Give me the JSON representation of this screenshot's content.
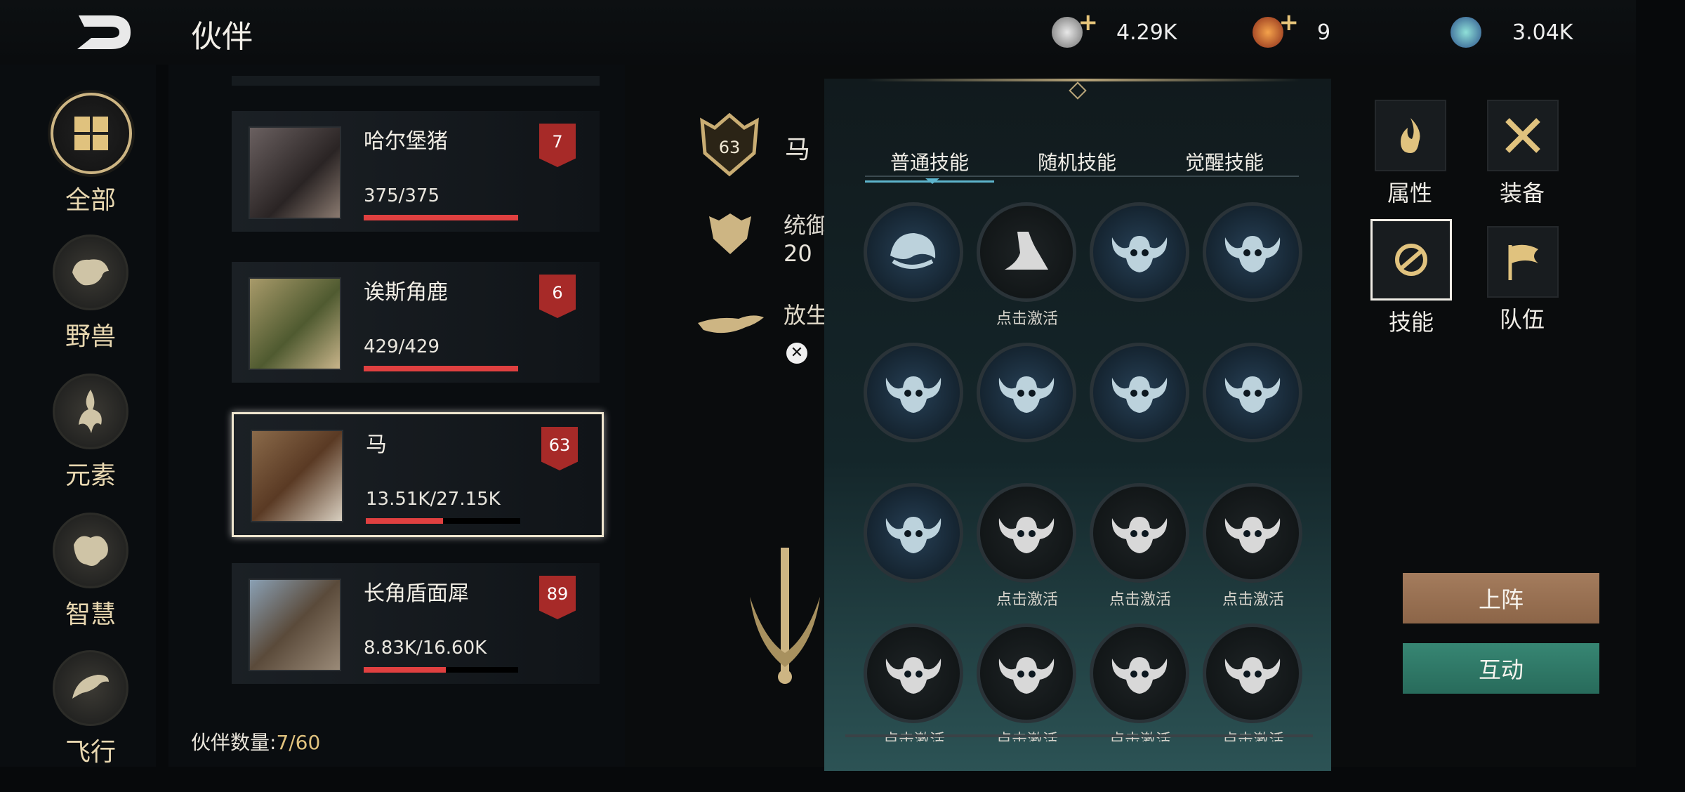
{
  "header": {
    "title": "伙伴",
    "currencies": [
      {
        "icon": "silver-coin-icon",
        "value": "4.29K",
        "has_plus": true
      },
      {
        "icon": "red-gem-icon",
        "value": "9",
        "has_plus": true
      },
      {
        "icon": "blue-orb-icon",
        "value": "3.04K",
        "has_plus": false
      }
    ]
  },
  "left_nav": {
    "items": [
      {
        "label": "全部",
        "icon": "grid-icon",
        "active": true
      },
      {
        "label": "野兽",
        "icon": "beast-icon",
        "active": false
      },
      {
        "label": "元素",
        "icon": "element-icon",
        "active": false
      },
      {
        "label": "智慧",
        "icon": "wisdom-icon",
        "active": false
      },
      {
        "label": "飞行",
        "icon": "flying-icon",
        "active": false
      }
    ]
  },
  "partners": [
    {
      "name": "哈尔堡猪",
      "hp": "375/375",
      "hp_ratio": 1.0,
      "level": "7",
      "selected": false
    },
    {
      "name": "诶斯角鹿",
      "hp": "429/429",
      "hp_ratio": 1.0,
      "level": "6",
      "selected": false
    },
    {
      "name": "马",
      "hp": "13.51K/27.15K",
      "hp_ratio": 0.5,
      "level": "63",
      "selected": true
    },
    {
      "name": "长角盾面犀",
      "hp": "8.83K/16.60K",
      "hp_ratio": 0.53,
      "level": "89",
      "selected": false
    }
  ],
  "partner_count": {
    "label": "伙伴数量:",
    "value": "7/60"
  },
  "detail": {
    "level": "63",
    "name": "马",
    "stat_label": "统御值:",
    "stat_value": "20",
    "release_label": "放生"
  },
  "skills": {
    "tabs": [
      "普通技能",
      "随机技能",
      "觉醒技能"
    ],
    "active_tab": 0,
    "grid": [
      {
        "icon": "helmet-skill-icon",
        "caption": "",
        "active": true
      },
      {
        "icon": "claw-skill-icon",
        "caption": "点击激活",
        "active": false
      },
      {
        "icon": "bull-skill-icon",
        "caption": "",
        "active": true
      },
      {
        "icon": "bull-skill-icon",
        "caption": "",
        "active": true
      },
      {
        "icon": "bull-skill-icon",
        "caption": "",
        "active": true
      },
      {
        "icon": "bull-skill-icon",
        "caption": "",
        "active": true
      },
      {
        "icon": "bull-skill-icon",
        "caption": "",
        "active": true
      },
      {
        "icon": "bull-skill-icon",
        "caption": "",
        "active": true
      },
      {
        "icon": "bull-skill-icon",
        "caption": "",
        "active": true
      },
      {
        "icon": "bull-skill-icon",
        "caption": "点击激活",
        "active": false
      },
      {
        "icon": "bull-skill-icon",
        "caption": "点击激活",
        "active": false
      },
      {
        "icon": "bull-skill-icon",
        "caption": "点击激活",
        "active": false
      },
      {
        "icon": "bull-skill-icon",
        "caption": "点击激活",
        "active": false
      },
      {
        "icon": "bull-skill-icon",
        "caption": "点击激活",
        "active": false
      },
      {
        "icon": "bull-skill-icon",
        "caption": "点击激活",
        "active": false
      },
      {
        "icon": "bull-skill-icon",
        "caption": "点击激活",
        "active": false
      }
    ]
  },
  "right_menu": [
    {
      "label": "属性",
      "icon": "flame-icon",
      "selected": false
    },
    {
      "label": "装备",
      "icon": "crossed-swords-icon",
      "selected": false
    },
    {
      "label": "技能",
      "icon": "skill-icon",
      "selected": true
    },
    {
      "label": "队伍",
      "icon": "flag-icon",
      "selected": false
    }
  ],
  "buttons": {
    "deploy": "上阵",
    "interact": "互动"
  },
  "colors": {
    "accent_gold": "#cdb583",
    "hp_red": "#e04040",
    "level_red": "#a72a28",
    "deploy_btn": "#9a7357",
    "interact_btn": "#2f7a6b"
  }
}
